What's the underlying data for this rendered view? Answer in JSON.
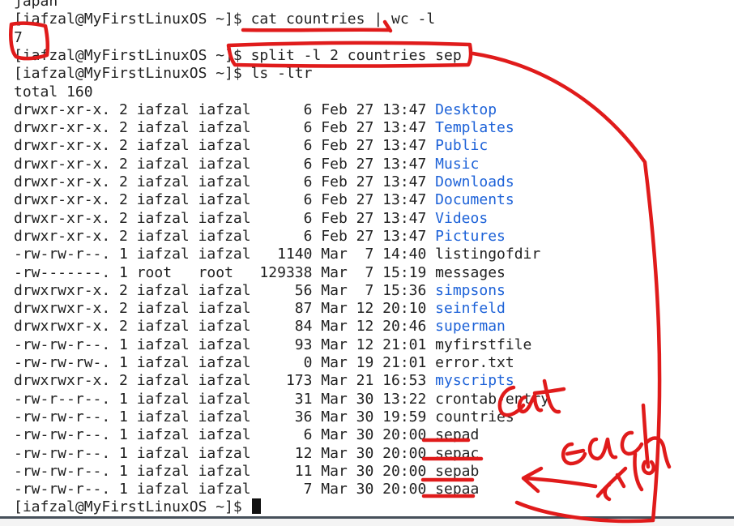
{
  "colors": {
    "text": "#222222",
    "directory": "#1d62d8",
    "annotation": "#e01b1b",
    "background": "#ffffff"
  },
  "terminal": {
    "lines": [
      {
        "segments": [
          {
            "text": "japan"
          }
        ]
      },
      {
        "segments": [
          {
            "text": "[iafzal@MyFirstLinuxOS ~]$ cat countries | wc -l"
          }
        ]
      },
      {
        "segments": [
          {
            "text": "7"
          }
        ]
      },
      {
        "segments": [
          {
            "text": "[iafzal@MyFirstLinuxOS ~]$ split -l 2 countries sep"
          }
        ]
      },
      {
        "segments": [
          {
            "text": "[iafzal@MyFirstLinuxOS ~]$ ls -ltr"
          }
        ]
      },
      {
        "segments": [
          {
            "text": "total 160"
          }
        ]
      },
      {
        "segments": [
          {
            "text": "drwxr-xr-x. 2 iafzal iafzal      6 Feb 27 13:47 "
          },
          {
            "text": "Desktop",
            "dir": true
          }
        ]
      },
      {
        "segments": [
          {
            "text": "drwxr-xr-x. 2 iafzal iafzal      6 Feb 27 13:47 "
          },
          {
            "text": "Templates",
            "dir": true
          }
        ]
      },
      {
        "segments": [
          {
            "text": "drwxr-xr-x. 2 iafzal iafzal      6 Feb 27 13:47 "
          },
          {
            "text": "Public",
            "dir": true
          }
        ]
      },
      {
        "segments": [
          {
            "text": "drwxr-xr-x. 2 iafzal iafzal      6 Feb 27 13:47 "
          },
          {
            "text": "Music",
            "dir": true
          }
        ]
      },
      {
        "segments": [
          {
            "text": "drwxr-xr-x. 2 iafzal iafzal      6 Feb 27 13:47 "
          },
          {
            "text": "Downloads",
            "dir": true
          }
        ]
      },
      {
        "segments": [
          {
            "text": "drwxr-xr-x. 2 iafzal iafzal      6 Feb 27 13:47 "
          },
          {
            "text": "Documents",
            "dir": true
          }
        ]
      },
      {
        "segments": [
          {
            "text": "drwxr-xr-x. 2 iafzal iafzal      6 Feb 27 13:47 "
          },
          {
            "text": "Videos",
            "dir": true
          }
        ]
      },
      {
        "segments": [
          {
            "text": "drwxr-xr-x. 2 iafzal iafzal      6 Feb 27 13:47 "
          },
          {
            "text": "Pictures",
            "dir": true
          }
        ]
      },
      {
        "segments": [
          {
            "text": "-rw-rw-r--. 1 iafzal iafzal   1140 Mar  7 14:40 listingofdir"
          }
        ]
      },
      {
        "segments": [
          {
            "text": "-rw-------. 1 root   root   129338 Mar  7 15:19 messages"
          }
        ]
      },
      {
        "segments": [
          {
            "text": "drwxrwxr-x. 2 iafzal iafzal     56 Mar  7 15:36 "
          },
          {
            "text": "simpsons",
            "dir": true
          }
        ]
      },
      {
        "segments": [
          {
            "text": "drwxrwxr-x. 2 iafzal iafzal     87 Mar 12 20:10 "
          },
          {
            "text": "seinfeld",
            "dir": true
          }
        ]
      },
      {
        "segments": [
          {
            "text": "drwxrwxr-x. 2 iafzal iafzal     84 Mar 12 20:46 "
          },
          {
            "text": "superman",
            "dir": true
          }
        ]
      },
      {
        "segments": [
          {
            "text": "-rw-rw-r--. 1 iafzal iafzal     93 Mar 12 21:01 myfirstfile"
          }
        ]
      },
      {
        "segments": [
          {
            "text": "-rw-rw-rw-. 1 iafzal iafzal      0 Mar 19 21:01 error.txt"
          }
        ]
      },
      {
        "segments": [
          {
            "text": "drwxrwxr-x. 2 iafzal iafzal    173 Mar 21 16:53 "
          },
          {
            "text": "myscripts",
            "dir": true
          }
        ]
      },
      {
        "segments": [
          {
            "text": "-rw-r--r--. 1 iafzal iafzal     31 Mar 30 13:22 crontab-entry"
          }
        ]
      },
      {
        "segments": [
          {
            "text": "-rw-rw-r--. 1 iafzal iafzal     36 Mar 30 19:59 countries"
          }
        ]
      },
      {
        "segments": [
          {
            "text": "-rw-rw-r--. 1 iafzal iafzal      6 Mar 30 20:00 sepad"
          }
        ]
      },
      {
        "segments": [
          {
            "text": "-rw-rw-r--. 1 iafzal iafzal     12 Mar 30 20:00 sepac"
          }
        ]
      },
      {
        "segments": [
          {
            "text": "-rw-rw-r--. 1 iafzal iafzal     11 Mar 30 20:00 sepab"
          }
        ]
      },
      {
        "segments": [
          {
            "text": "-rw-rw-r--. 1 iafzal iafzal      7 Mar 30 20:00 sepaa"
          }
        ]
      },
      {
        "segments": [
          {
            "text": "[iafzal@MyFirstLinuxOS ~]$ "
          }
        ],
        "cursor": true
      }
    ]
  },
  "annotation": {
    "handwritten_note": "cat each file"
  }
}
